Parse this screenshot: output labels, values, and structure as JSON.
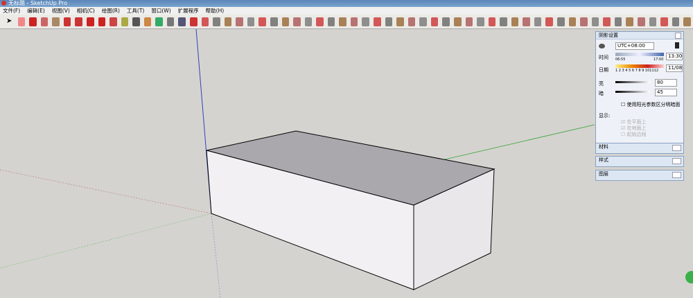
{
  "window": {
    "title": "无标题 - SketchUp Pro"
  },
  "menu": [
    "文件(F)",
    "编辑(E)",
    "视图(V)",
    "相机(C)",
    "绘图(R)",
    "工具(T)",
    "窗口(W)",
    "扩展程序",
    "帮助(H)"
  ],
  "toolbar_icons": [
    "select-icon",
    "eraser-icon",
    "pencil-icon",
    "arc-icon",
    "rectangle-icon",
    "push-pull-icon",
    "follow-me-icon",
    "move-icon",
    "rotate-icon",
    "scale-icon",
    "tape-measure-icon",
    "text-icon",
    "paint-bucket-icon",
    "orbit-icon",
    "pan-icon",
    "zoom-icon",
    "zoom-extents-icon"
  ],
  "shadow_panel": {
    "title": "阴影设置",
    "timezone": "UTC+08:00",
    "time_label": "时间",
    "time_start": "06:55",
    "time_end": "17:00",
    "time_value": "13:30",
    "date_label": "日期",
    "months": "1 2 3 4 5 6 7 8 9 101112",
    "date_value": "11/08",
    "light_label": "亮",
    "light_value": "80",
    "dark_label": "暗",
    "dark_value": "45",
    "use_sun_label": "使用阳光参数区分明暗面",
    "display_label": "显示:",
    "on_faces": "在平面上",
    "on_ground": "在地面上",
    "from_edges": "起始边线"
  },
  "trays": [
    "材料",
    "样式",
    "图层"
  ],
  "colors": {
    "axis_red": "#c04040",
    "axis_green": "#30a030",
    "axis_blue": "#3040c0",
    "top_face": "#aaa7ad",
    "front_face": "#f2f0f3"
  }
}
